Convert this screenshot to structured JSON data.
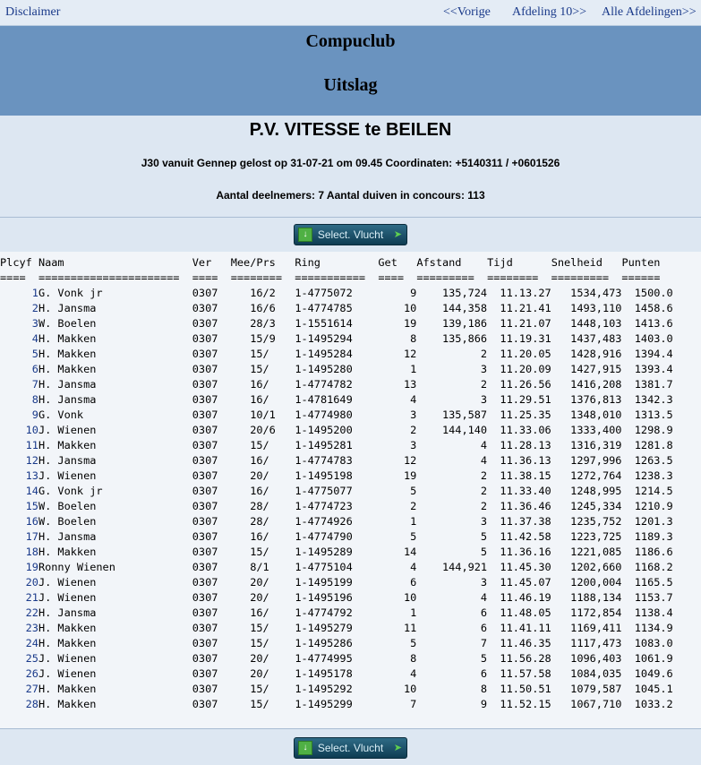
{
  "nav": {
    "disclaimer": "Disclaimer",
    "prev": "<<Vorige",
    "afdeling": "Afdeling 10>>",
    "alle": "Alle Afdelingen>>"
  },
  "header": {
    "title": "Compuclub",
    "subtitle": "Uitslag"
  },
  "race": {
    "club": "P.V. VITESSE te BEILEN",
    "info": "J30 vanuit Gennep gelost op 31-07-21 om 09.45 Coordinaten: +5140311 / +0601526",
    "participants": "Aantal deelnemers: 7 Aantal duiven in concours: 113"
  },
  "button_label": "Select. Vlucht",
  "columns": [
    "Plcyf",
    "Naam",
    "Ver",
    "Mee/Prs",
    "Ring",
    "Get",
    "Afstand",
    "Tijd",
    "Snelheid",
    "Punten"
  ],
  "rows": [
    [
      "1",
      "G. Vonk jr",
      "0307",
      "16/2",
      "1-4775072",
      "9",
      "135,724",
      "11.13.27",
      "1534,473",
      "1500.0"
    ],
    [
      "2",
      "H. Jansma",
      "0307",
      "16/6",
      "1-4774785",
      "10",
      "144,358",
      "11.21.41",
      "1493,110",
      "1458.6"
    ],
    [
      "3",
      "W. Boelen",
      "0307",
      "28/3",
      "1-1551614",
      "19",
      "139,186",
      "11.21.07",
      "1448,103",
      "1413.6"
    ],
    [
      "4",
      "H. Makken",
      "0307",
      "15/9",
      "1-1495294",
      "8",
      "135,866",
      "11.19.31",
      "1437,483",
      "1403.0"
    ],
    [
      "5",
      "H. Makken",
      "0307",
      "15/",
      "1-1495284",
      "12",
      "2",
      "11.20.05",
      "1428,916",
      "1394.4"
    ],
    [
      "6",
      "H. Makken",
      "0307",
      "15/",
      "1-1495280",
      "1",
      "3",
      "11.20.09",
      "1427,915",
      "1393.4"
    ],
    [
      "7",
      "H. Jansma",
      "0307",
      "16/",
      "1-4774782",
      "13",
      "2",
      "11.26.56",
      "1416,208",
      "1381.7"
    ],
    [
      "8",
      "H. Jansma",
      "0307",
      "16/",
      "1-4781649",
      "4",
      "3",
      "11.29.51",
      "1376,813",
      "1342.3"
    ],
    [
      "9",
      "G. Vonk",
      "0307",
      "10/1",
      "1-4774980",
      "3",
      "135,587",
      "11.25.35",
      "1348,010",
      "1313.5"
    ],
    [
      "10",
      "J. Wienen",
      "0307",
      "20/6",
      "1-1495200",
      "2",
      "144,140",
      "11.33.06",
      "1333,400",
      "1298.9"
    ],
    [
      "11",
      "H. Makken",
      "0307",
      "15/",
      "1-1495281",
      "3",
      "4",
      "11.28.13",
      "1316,319",
      "1281.8"
    ],
    [
      "12",
      "H. Jansma",
      "0307",
      "16/",
      "1-4774783",
      "12",
      "4",
      "11.36.13",
      "1297,996",
      "1263.5"
    ],
    [
      "13",
      "J. Wienen",
      "0307",
      "20/",
      "1-1495198",
      "19",
      "2",
      "11.38.15",
      "1272,764",
      "1238.3"
    ],
    [
      "14",
      "G. Vonk jr",
      "0307",
      "16/",
      "1-4775077",
      "5",
      "2",
      "11.33.40",
      "1248,995",
      "1214.5"
    ],
    [
      "15",
      "W. Boelen",
      "0307",
      "28/",
      "1-4774723",
      "2",
      "2",
      "11.36.46",
      "1245,334",
      "1210.9"
    ],
    [
      "16",
      "W. Boelen",
      "0307",
      "28/",
      "1-4774926",
      "1",
      "3",
      "11.37.38",
      "1235,752",
      "1201.3"
    ],
    [
      "17",
      "H. Jansma",
      "0307",
      "16/",
      "1-4774790",
      "5",
      "5",
      "11.42.58",
      "1223,725",
      "1189.3"
    ],
    [
      "18",
      "H. Makken",
      "0307",
      "15/",
      "1-1495289",
      "14",
      "5",
      "11.36.16",
      "1221,085",
      "1186.6"
    ],
    [
      "19",
      "Ronny Wienen",
      "0307",
      "8/1",
      "1-4775104",
      "4",
      "144,921",
      "11.45.30",
      "1202,660",
      "1168.2"
    ],
    [
      "20",
      "J. Wienen",
      "0307",
      "20/",
      "1-1495199",
      "6",
      "3",
      "11.45.07",
      "1200,004",
      "1165.5"
    ],
    [
      "21",
      "J. Wienen",
      "0307",
      "20/",
      "1-1495196",
      "10",
      "4",
      "11.46.19",
      "1188,134",
      "1153.7"
    ],
    [
      "22",
      "H. Jansma",
      "0307",
      "16/",
      "1-4774792",
      "1",
      "6",
      "11.48.05",
      "1172,854",
      "1138.4"
    ],
    [
      "23",
      "H. Makken",
      "0307",
      "15/",
      "1-1495279",
      "11",
      "6",
      "11.41.11",
      "1169,411",
      "1134.9"
    ],
    [
      "24",
      "H. Makken",
      "0307",
      "15/",
      "1-1495286",
      "5",
      "7",
      "11.46.35",
      "1117,473",
      "1083.0"
    ],
    [
      "25",
      "J. Wienen",
      "0307",
      "20/",
      "1-4774995",
      "8",
      "5",
      "11.56.28",
      "1096,403",
      "1061.9"
    ],
    [
      "26",
      "J. Wienen",
      "0307",
      "20/",
      "1-1495178",
      "4",
      "6",
      "11.57.58",
      "1084,035",
      "1049.6"
    ],
    [
      "27",
      "H. Makken",
      "0307",
      "15/",
      "1-1495292",
      "10",
      "8",
      "11.50.51",
      "1079,587",
      "1045.1"
    ],
    [
      "28",
      "H. Makken",
      "0307",
      "15/",
      "1-1495299",
      "7",
      "9",
      "11.52.15",
      "1067,710",
      "1033.2"
    ]
  ]
}
